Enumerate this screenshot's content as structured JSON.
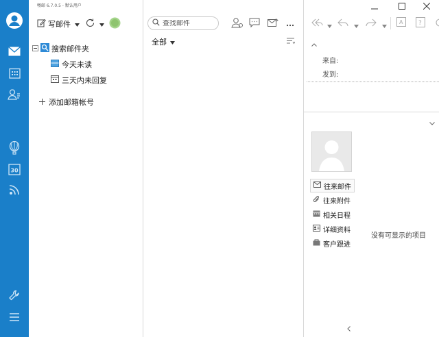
{
  "app": {
    "version_text": "畅邮 6.7.0.5 - 默认用户"
  },
  "rail": {
    "items": [
      {
        "name": "avatar"
      },
      {
        "name": "mail-icon"
      },
      {
        "name": "calendar-icon"
      },
      {
        "name": "contacts-icon"
      },
      {
        "name": "balloon-icon"
      },
      {
        "name": "date-30-icon"
      },
      {
        "name": "rss-icon"
      },
      {
        "name": "wrench-icon"
      },
      {
        "name": "menu-icon"
      }
    ],
    "accent": "#1a7fc9"
  },
  "toolbar": {
    "compose_label": "写邮件"
  },
  "folders": {
    "search_folder_label": "搜索邮件夹",
    "children": [
      {
        "label": "今天未读"
      },
      {
        "label": "三天内未回复"
      }
    ],
    "add_account_label": "添加邮箱帐号"
  },
  "list": {
    "search_placeholder": "查找邮件",
    "filter_label": "全部"
  },
  "reader": {
    "from_label": "来自:",
    "to_label": "发到:",
    "side_items": [
      {
        "label": "往来邮件",
        "icon": "envelope-icon"
      },
      {
        "label": "往来附件",
        "icon": "paperclip-icon"
      },
      {
        "label": "相关日程",
        "icon": "calendar-small-icon"
      },
      {
        "label": "详细资料",
        "icon": "id-card-icon"
      },
      {
        "label": "客户跟进",
        "icon": "followup-icon"
      }
    ],
    "empty_text": "没有可显示的项目"
  }
}
